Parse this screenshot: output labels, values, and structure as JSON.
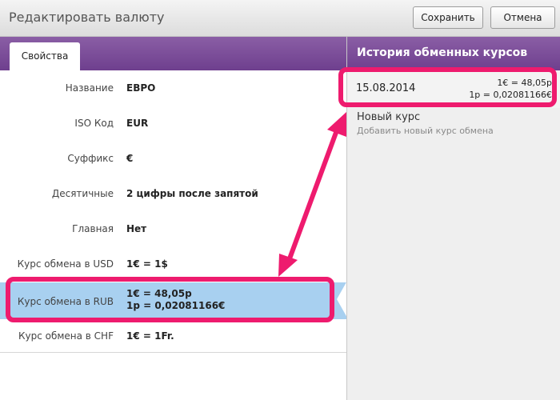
{
  "window": {
    "title": "Редактировать валюту",
    "save_label": "Сохранить",
    "cancel_label": "Отмена"
  },
  "tabs": [
    {
      "label": "Свойства",
      "active": true
    }
  ],
  "properties": [
    {
      "label": "Название",
      "value": "ЕВРО"
    },
    {
      "label": "ISO Код",
      "value": "EUR"
    },
    {
      "label": "Суффикс",
      "value": "€"
    },
    {
      "label": "Десятичные",
      "value": "2 цифры после запятой"
    },
    {
      "label": "Главная",
      "value": "Нет"
    },
    {
      "label": "Курс обмена в USD",
      "value": "1€ = 1$"
    },
    {
      "label": "Курс обмена в RUB",
      "value_line1": "1€ = 48,05р",
      "value_line2": "1р = 0,02081166€",
      "selected": true
    },
    {
      "label": "Курс обмена в CHF",
      "value": "1€ = 1Fr."
    }
  ],
  "history": {
    "title": "История обменных курсов",
    "items": [
      {
        "date": "15.08.2014",
        "rate1": "1€ = 48,05р",
        "rate2": "1р = 0,02081166€"
      }
    ],
    "new_rate_label": "Новый курс",
    "new_rate_hint": "Добавить новый курс обмена"
  },
  "colors": {
    "accent_purple": "#7a4a9a",
    "selection_blue": "#a8d0f0",
    "annotation_pink": "#ee1b6e"
  }
}
